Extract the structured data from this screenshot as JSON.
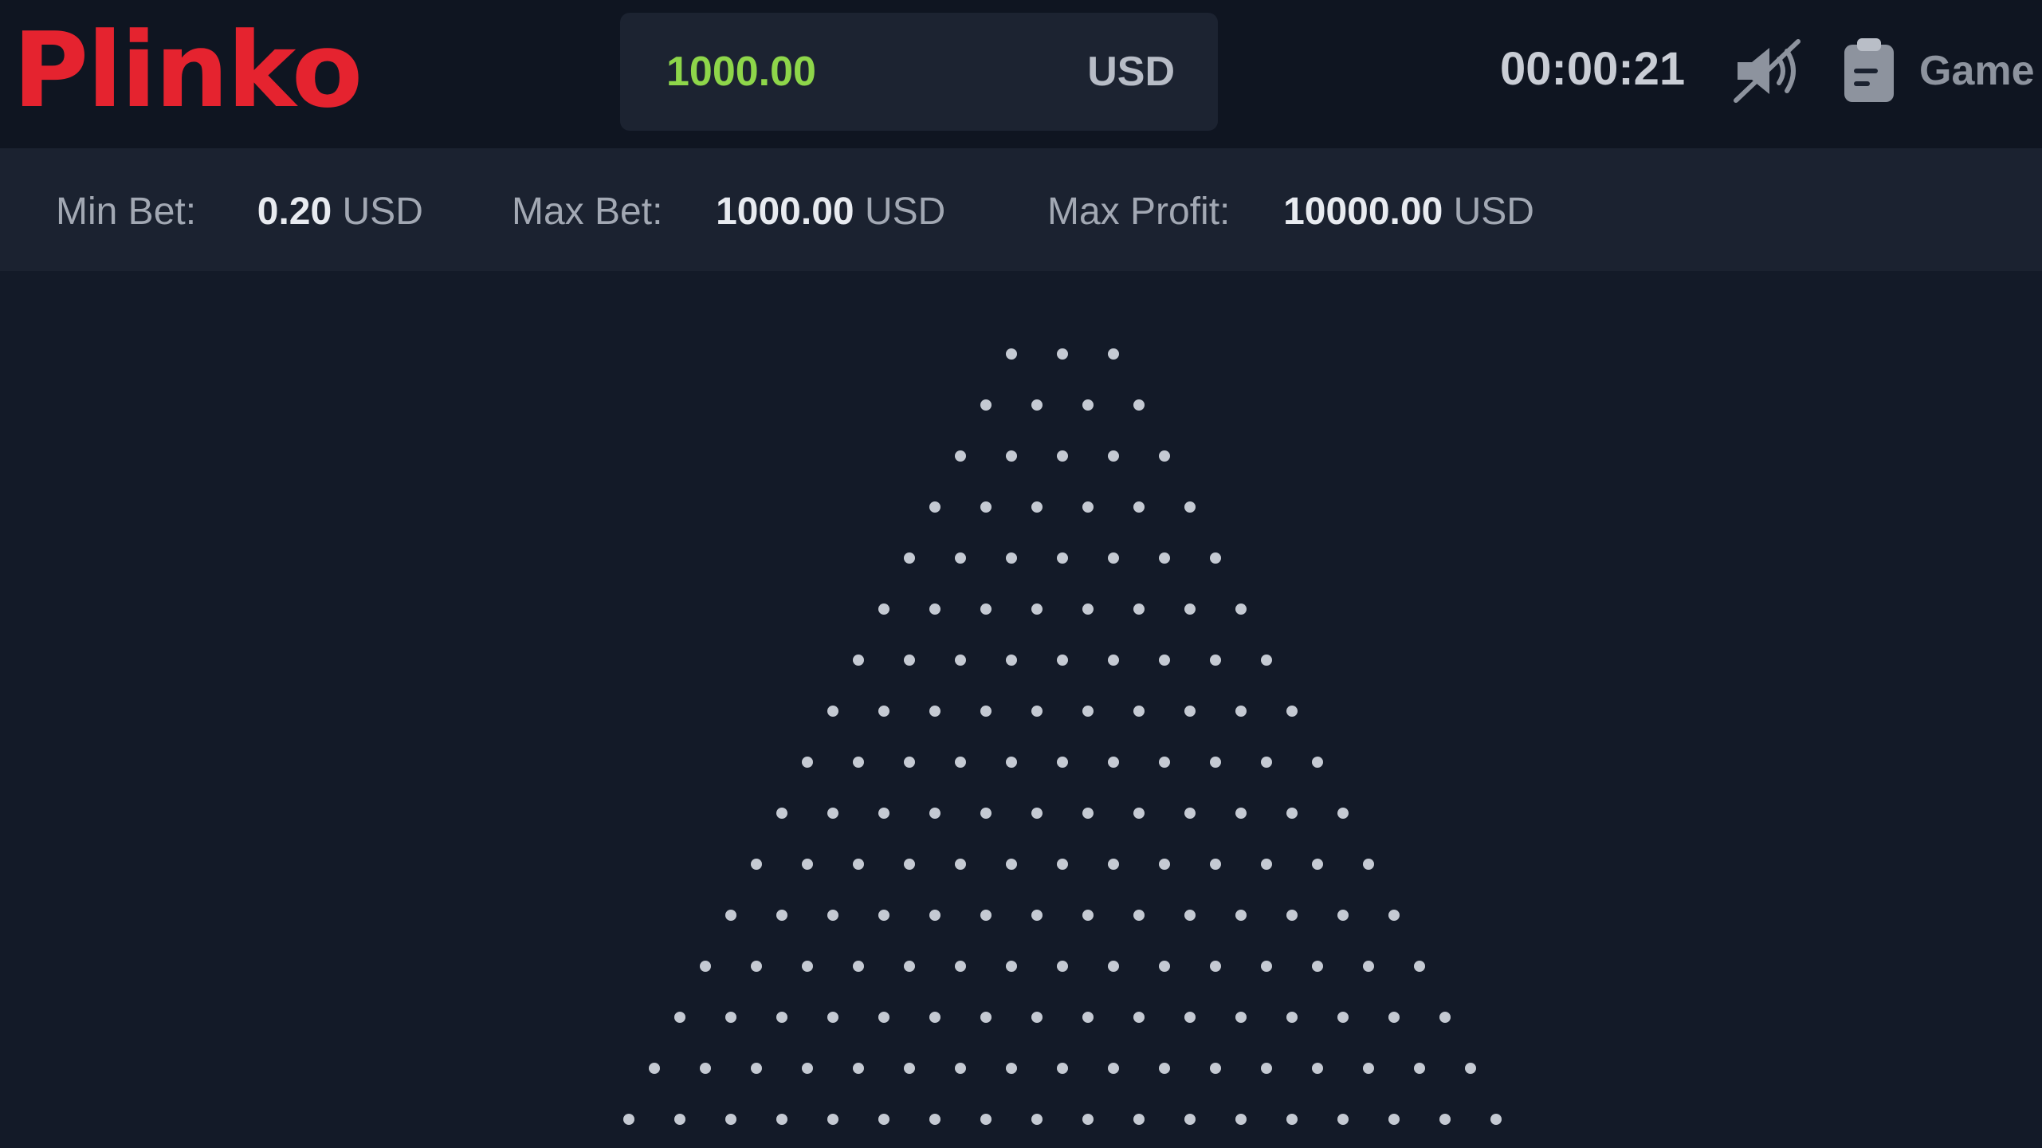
{
  "header": {
    "logo_text": "Plinko",
    "balance": {
      "value": "1000.00",
      "currency": "USD"
    },
    "timer": "00:00:21",
    "sound_icon": "sound-muted-icon",
    "game_button": {
      "icon": "clipboard-icon",
      "label": "Game"
    }
  },
  "limits": {
    "min_bet": {
      "label": "Min Bet:",
      "value": "0.20",
      "currency": "USD"
    },
    "max_bet": {
      "label": "Max Bet:",
      "value": "1000.00",
      "currency": "USD"
    },
    "max_profit": {
      "label": "Max Profit:",
      "value": "10000.00",
      "currency": "USD"
    }
  },
  "board": {
    "rows": 16,
    "first_row_pegs": 3,
    "peg_color": "#c5cad3",
    "bucket_colors": [
      "#e5232f",
      "#e8402c",
      "#ec5f2a",
      "#f07c27",
      "#f39a24",
      "#f5b521",
      "#f7c91f",
      "#f8d21e",
      "#f7c91f",
      "#f5b521",
      "#f39a24",
      "#f07c27",
      "#ec5f2a",
      "#e8402c",
      "#e5232f",
      "#e21d2b"
    ]
  },
  "colors": {
    "brand": "#e5232f",
    "balance_green": "#8ed64a",
    "background": "#131a28"
  }
}
